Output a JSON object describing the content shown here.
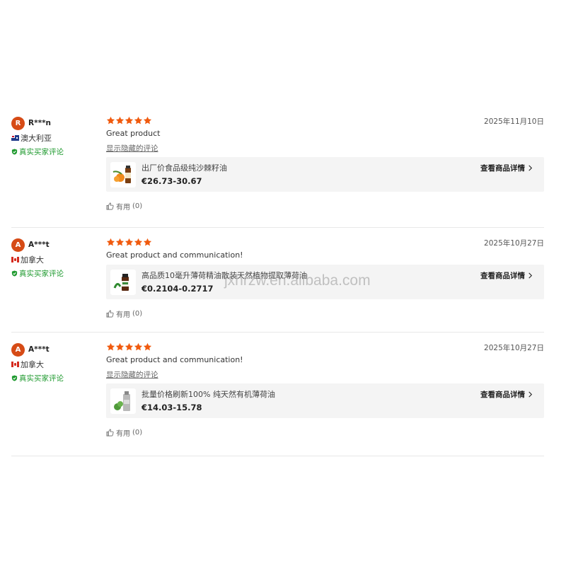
{
  "reviews": [
    {
      "avatar_letter": "R",
      "avatar_color": "#d64b16",
      "username": "R***n",
      "country": "澳大利亚",
      "flag": "australia-flag",
      "verified": "真实买家评论",
      "rating": 5,
      "date": "2025年11月10日",
      "comment": "Great product",
      "toggle": "显示隐藏的评论",
      "product": {
        "title": "出厂价食品级纯沙棘籽油",
        "price": "€26.73-30.67",
        "detail_link": "查看商品详情"
      },
      "helpful_label": "有用",
      "helpful_count": "(0)"
    },
    {
      "avatar_letter": "A",
      "avatar_color": "#d64b16",
      "username": "A***t",
      "country": "加拿大",
      "flag": "canada-flag",
      "verified": "真实买家评论",
      "rating": 5,
      "date": "2025年10月27日",
      "comment": "Great product and communication!",
      "toggle": "",
      "product": {
        "title": "高品质10毫升薄荷精油散装天然植物提取薄荷油",
        "price": "€0.2104-0.2717",
        "detail_link": "查看商品详情"
      },
      "helpful_label": "有用",
      "helpful_count": "(0)"
    },
    {
      "avatar_letter": "A",
      "avatar_color": "#d64b16",
      "username": "A***t",
      "country": "加拿大",
      "flag": "canada-flag",
      "verified": "真实买家评论",
      "rating": 5,
      "date": "2025年10月27日",
      "comment": "Great product and communication!",
      "toggle": "显示隐藏的评论",
      "product": {
        "title": "批量价格刷新100% 纯天然有机薄荷油",
        "price": "€14.03-15.78",
        "detail_link": "查看商品详情"
      },
      "helpful_label": "有用",
      "helpful_count": "(0)"
    }
  ],
  "watermark": "jxhrzw.en.alibaba.com",
  "colors": {
    "star": "#f05a0e",
    "verified": "#1f9a2f",
    "card_bg": "#f4f4f4"
  }
}
